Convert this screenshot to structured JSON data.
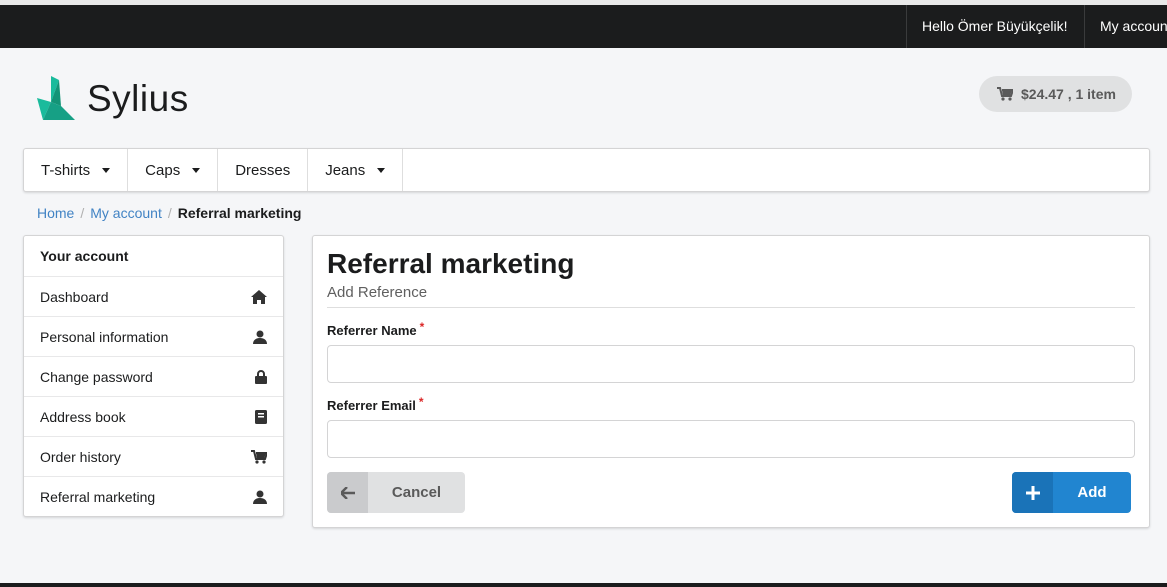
{
  "topbar": {
    "greeting": "Hello Ömer Büyükçelik!",
    "my_account": "My account"
  },
  "logo": {
    "text": "Sylius"
  },
  "cart": {
    "summary": "$24.47 , 1 item"
  },
  "menu": {
    "items": [
      {
        "label": "T-shirts",
        "dropdown": true
      },
      {
        "label": "Caps",
        "dropdown": true
      },
      {
        "label": "Dresses",
        "dropdown": false
      },
      {
        "label": "Jeans",
        "dropdown": true
      }
    ]
  },
  "breadcrumb": {
    "home": "Home",
    "account": "My account",
    "current": "Referral marketing"
  },
  "sidebar": {
    "header": "Your account",
    "items": [
      {
        "label": "Dashboard",
        "icon": "home-icon"
      },
      {
        "label": "Personal information",
        "icon": "user-icon"
      },
      {
        "label": "Change password",
        "icon": "lock-icon"
      },
      {
        "label": "Address book",
        "icon": "book-icon"
      },
      {
        "label": "Order history",
        "icon": "cart-icon"
      },
      {
        "label": "Referral marketing",
        "icon": "user-icon"
      }
    ]
  },
  "main": {
    "title": "Referral marketing",
    "subtitle": "Add Reference",
    "fields": {
      "name_label": "Referrer Name",
      "name_value": "",
      "email_label": "Referrer Email",
      "email_value": "",
      "required_mark": "*"
    },
    "cancel_label": "Cancel",
    "add_label": "Add"
  },
  "colors": {
    "primary": "#2185d0",
    "link": "#4183c4",
    "topbar": "#1b1c1d",
    "required": "#db2828"
  }
}
